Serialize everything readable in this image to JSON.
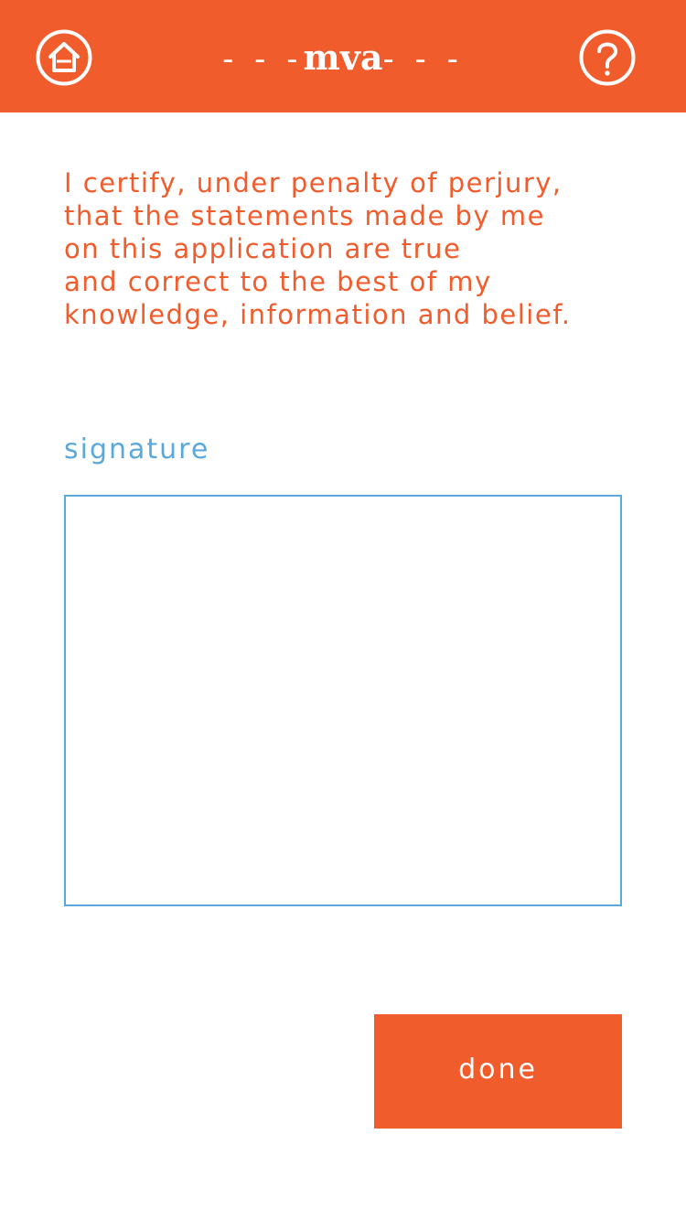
{
  "header": {
    "title_prefix": "- - -",
    "title": "mva",
    "title_suffix": "- - -",
    "home_icon": "home-icon",
    "help_icon": "help-icon"
  },
  "statement": {
    "lines": [
      "I certify, under penalty of perjury,",
      "that the statements made by me",
      "on this application are true",
      "and correct to the best of my",
      "knowledge, information and belief."
    ]
  },
  "signature": {
    "label": "signature"
  },
  "actions": {
    "done_label": "done"
  },
  "colors": {
    "brand_orange": "#f15c2c",
    "accent_blue": "#5aa9db",
    "background": "#ffffff"
  }
}
